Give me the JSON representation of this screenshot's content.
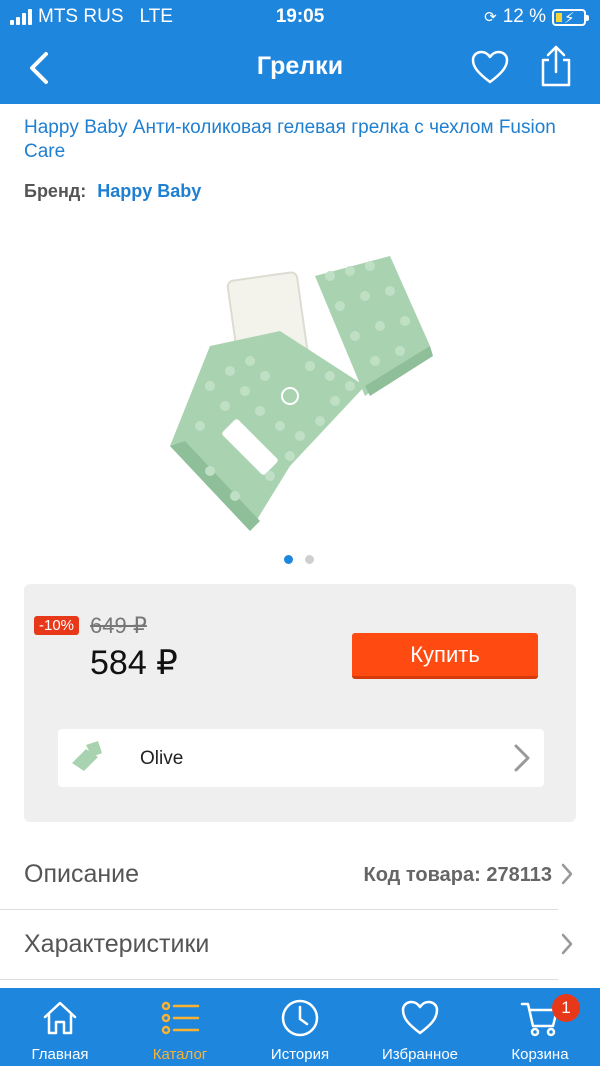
{
  "status_bar": {
    "carrier": "MTS RUS",
    "network": "LTE",
    "time": "19:05",
    "battery": "12 %",
    "battery_level": 0.12
  },
  "nav": {
    "title": "Грелки",
    "back_icon": "chevron-left-icon",
    "favorite_icon": "heart-icon",
    "share_icon": "share-icon"
  },
  "product": {
    "title": "Happy Baby Анти-коликовая гелевая грелка с чехлом Fusion Care",
    "brand_label": "Бренд:",
    "brand": "Happy Baby",
    "image_count": 2,
    "active_image": 1
  },
  "price": {
    "discount": "-10%",
    "old_price": "649 ₽",
    "new_price": "584 ₽",
    "buy_label": "Купить"
  },
  "variant": {
    "label": "Olive"
  },
  "info_rows": [
    {
      "label": "Описание",
      "meta": "Код товара: 278113"
    },
    {
      "label": "Характеристики",
      "meta": ""
    }
  ],
  "tabs": [
    {
      "label": "Главная",
      "icon": "home-icon"
    },
    {
      "label": "Каталог",
      "icon": "catalog-list-icon",
      "active": true
    },
    {
      "label": "История",
      "icon": "clock-icon"
    },
    {
      "label": "Избранное",
      "icon": "heart-icon"
    },
    {
      "label": "Корзина",
      "icon": "cart-icon",
      "badge": "1"
    }
  ],
  "colors": {
    "primary": "#1f86dd",
    "link": "#1f7fd0",
    "buy": "#ff4a12",
    "discount": "#e8381a",
    "active_tab": "#f9b233",
    "product_green": "#a9d3b0"
  }
}
